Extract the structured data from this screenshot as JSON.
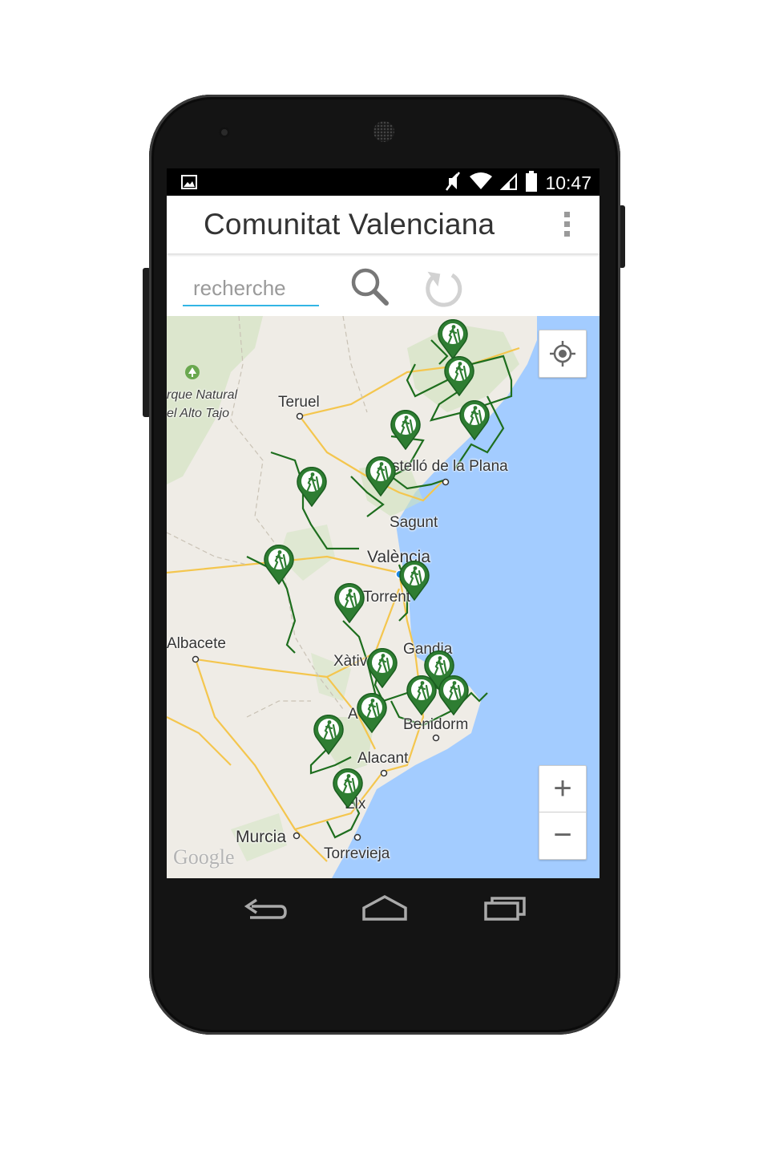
{
  "status_bar": {
    "time": "10:47",
    "icons": [
      "image-icon",
      "mute-icon",
      "wifi-icon",
      "signal-icon",
      "battery-icon"
    ]
  },
  "action_bar": {
    "title": "Comunitat Valenciana",
    "overflow_icon": "overflow-menu-icon"
  },
  "search": {
    "placeholder": "recherche",
    "value": "",
    "search_icon": "search-icon",
    "refresh_icon": "refresh-icon"
  },
  "map": {
    "labels": [
      {
        "id": "parque",
        "text": "rque Natural"
      },
      {
        "id": "alto-tajo",
        "text": "el Alto Tajo"
      },
      {
        "id": "teruel",
        "text": "Teruel"
      },
      {
        "id": "castello",
        "text": "stelló de la Plana"
      },
      {
        "id": "sagunt",
        "text": "Sagunt"
      },
      {
        "id": "valencia",
        "text": "València"
      },
      {
        "id": "torrent",
        "text": "Torrent"
      },
      {
        "id": "albacete",
        "text": "Albacete"
      },
      {
        "id": "gandia",
        "text": "Gandia"
      },
      {
        "id": "xativa",
        "text": "Xàtiv"
      },
      {
        "id": "a",
        "text": "A"
      },
      {
        "id": "benidorm",
        "text": "Benidorm"
      },
      {
        "id": "alacant",
        "text": "Alacant"
      },
      {
        "id": "elx",
        "text": "Elx"
      },
      {
        "id": "murcia",
        "text": "Murcia"
      },
      {
        "id": "torrevieja",
        "text": "Torrevieja"
      }
    ],
    "google_logo": "Google",
    "marker_icon": "hiker-marker-icon",
    "marker_count": 16,
    "colors": {
      "trail": "#1e6e1e",
      "marker": "#2e7d32",
      "sea": "#a3ccff",
      "land": "#efece6",
      "road": "#f4c64e"
    }
  },
  "map_controls": {
    "locate_icon": "my-location-icon",
    "zoom_in": "+",
    "zoom_out": "−"
  },
  "nav_bar": {
    "icons": [
      "back-icon",
      "home-icon",
      "recents-icon"
    ]
  }
}
